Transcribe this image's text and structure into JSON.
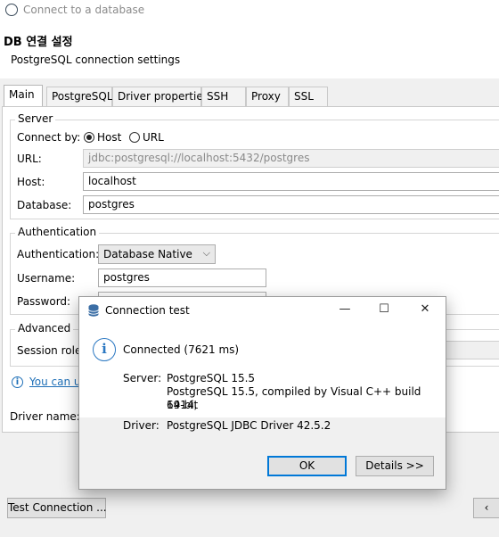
{
  "window": {
    "title": "Connect to a database",
    "icon": "dbeaver-icon"
  },
  "header": {
    "title": "DB 연결 설정",
    "subtitle": "PostgreSQL connection settings"
  },
  "tabs": [
    {
      "label": "Main",
      "active": true
    },
    {
      "label": "PostgreSQL"
    },
    {
      "label": "Driver properties"
    },
    {
      "label": "SSH"
    },
    {
      "label": "Proxy"
    },
    {
      "label": "SSL"
    }
  ],
  "server": {
    "legend": "Server",
    "connect_by_label": "Connect by:",
    "host_option": "Host",
    "url_option": "URL",
    "connect_by_selected": "Host",
    "url_label": "URL:",
    "url_value": "jdbc:postgresql://localhost:5432/postgres",
    "host_label": "Host:",
    "host_value": "localhost",
    "database_label": "Database:",
    "database_value": "postgres"
  },
  "auth": {
    "legend": "Authentication",
    "auth_label": "Authentication:",
    "auth_value": "Database Native",
    "username_label": "Username:",
    "username_value": "postgres",
    "password_label": "Password:"
  },
  "advanced": {
    "legend": "Advanced",
    "session_role_label": "Session role:"
  },
  "info_link": "You can u",
  "driver_label": "Driver name:",
  "bottom": {
    "test_connection": "Test Connection ..."
  },
  "dialog": {
    "title": "Connection test",
    "status": "Connected (7621 ms)",
    "server_label": "Server:",
    "server_lines": [
      "PostgreSQL 15.5",
      "PostgreSQL 15.5, compiled by Visual C++ build 1914,",
      "64-bit"
    ],
    "driver_label": "Driver:",
    "driver_value": "PostgreSQL JDBC Driver 42.5.2",
    "ok_button": "OK",
    "details_button": "Details >>",
    "minimize": "—",
    "maximize": "☐",
    "close": "✕"
  },
  "colors": {
    "accent": "#1e6fb7",
    "ok_border": "#0078d7"
  }
}
